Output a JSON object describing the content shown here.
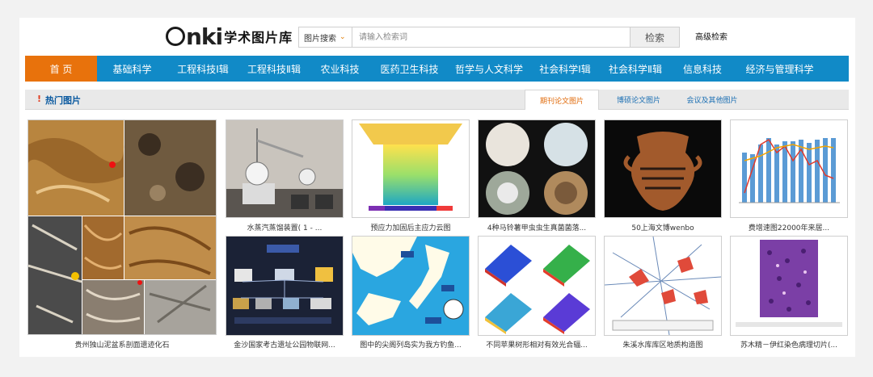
{
  "header": {
    "logo_mark": "nki",
    "logo_text": "学术图片库",
    "search_type": "图片搜索",
    "search_placeholder": "请输入检索词",
    "search_button": "检索",
    "advanced_link": "高级检索"
  },
  "nav": {
    "items": [
      "首 页",
      "基础科学",
      "工程科技Ⅰ辑",
      "工程科技Ⅱ辑",
      "农业科技",
      "医药卫生科技",
      "哲学与人文科学",
      "社会科学Ⅰ辑",
      "社会科学Ⅱ辑",
      "信息科技",
      "经济与管理科学"
    ]
  },
  "section": {
    "marker": "!",
    "title": "热门图片",
    "tabs": [
      "期刊论文图片",
      "博硕论文图片",
      "会议及其他图片"
    ]
  },
  "images": [
    {
      "caption": "贵州独山泥盆系剖面遗迹化石"
    },
    {
      "caption": "水蒸汽蒸馏装置( 1 - ..."
    },
    {
      "caption": "预应力加固后主应力云图"
    },
    {
      "caption": "4种马铃薯甲虫虫生真菌菌落..."
    },
    {
      "caption": "50上海文博wenbo"
    },
    {
      "caption": "费增速图22000年来居..."
    },
    {
      "caption": "金沙国家考古遗址公园物联网..."
    },
    {
      "caption": "图中的尖阁列岛实为我方钓鱼..."
    },
    {
      "caption": "不同苹果树形相对有效光合辐..."
    },
    {
      "caption": "朱溪水库库区地质构造图"
    },
    {
      "caption": "苏木精－伊红染色病理切片(..."
    }
  ],
  "colors": {
    "nav": "#118ac7",
    "nav_active": "#e8720c",
    "tab_active": "#e06a0a",
    "link": "#1b6fb3"
  }
}
